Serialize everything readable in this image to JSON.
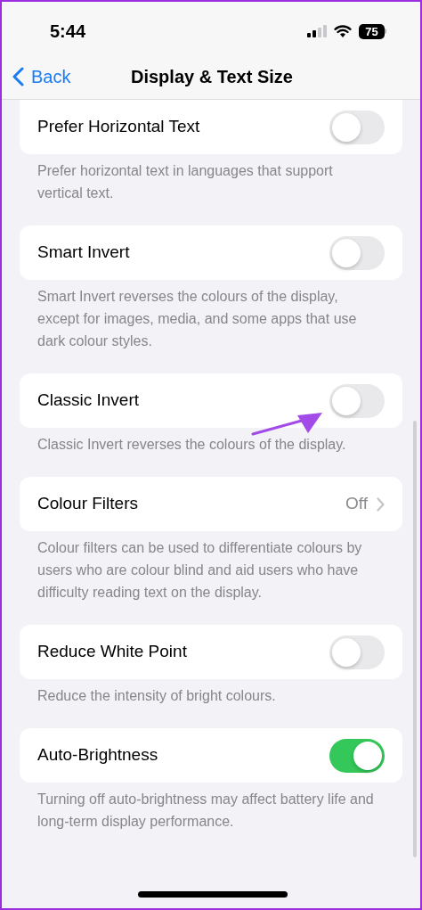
{
  "status_bar": {
    "time": "5:44",
    "battery": "75"
  },
  "nav": {
    "back": "Back",
    "title": "Display & Text Size"
  },
  "sections": [
    {
      "label": "Prefer Horizontal Text",
      "kind": "toggle",
      "on": false,
      "footer": "Prefer horizontal text in languages that support vertical text."
    },
    {
      "label": "Smart Invert",
      "kind": "toggle",
      "on": false,
      "footer": "Smart Invert reverses the colours of the display, except for images, media, and some apps that use dark colour styles."
    },
    {
      "label": "Classic Invert",
      "kind": "toggle",
      "on": false,
      "footer": "Classic Invert reverses the colours of the display."
    },
    {
      "label": "Colour Filters",
      "kind": "link",
      "value": "Off",
      "footer": "Colour filters can be used to differentiate colours by users who are colour blind and aid users who have difficulty reading text on the display."
    },
    {
      "label": "Reduce White Point",
      "kind": "toggle",
      "on": false,
      "footer": "Reduce the intensity of bright colours."
    },
    {
      "label": "Auto-Brightness",
      "kind": "toggle",
      "on": true,
      "footer": "Turning off auto-brightness may affect battery life and long-term display performance."
    }
  ]
}
